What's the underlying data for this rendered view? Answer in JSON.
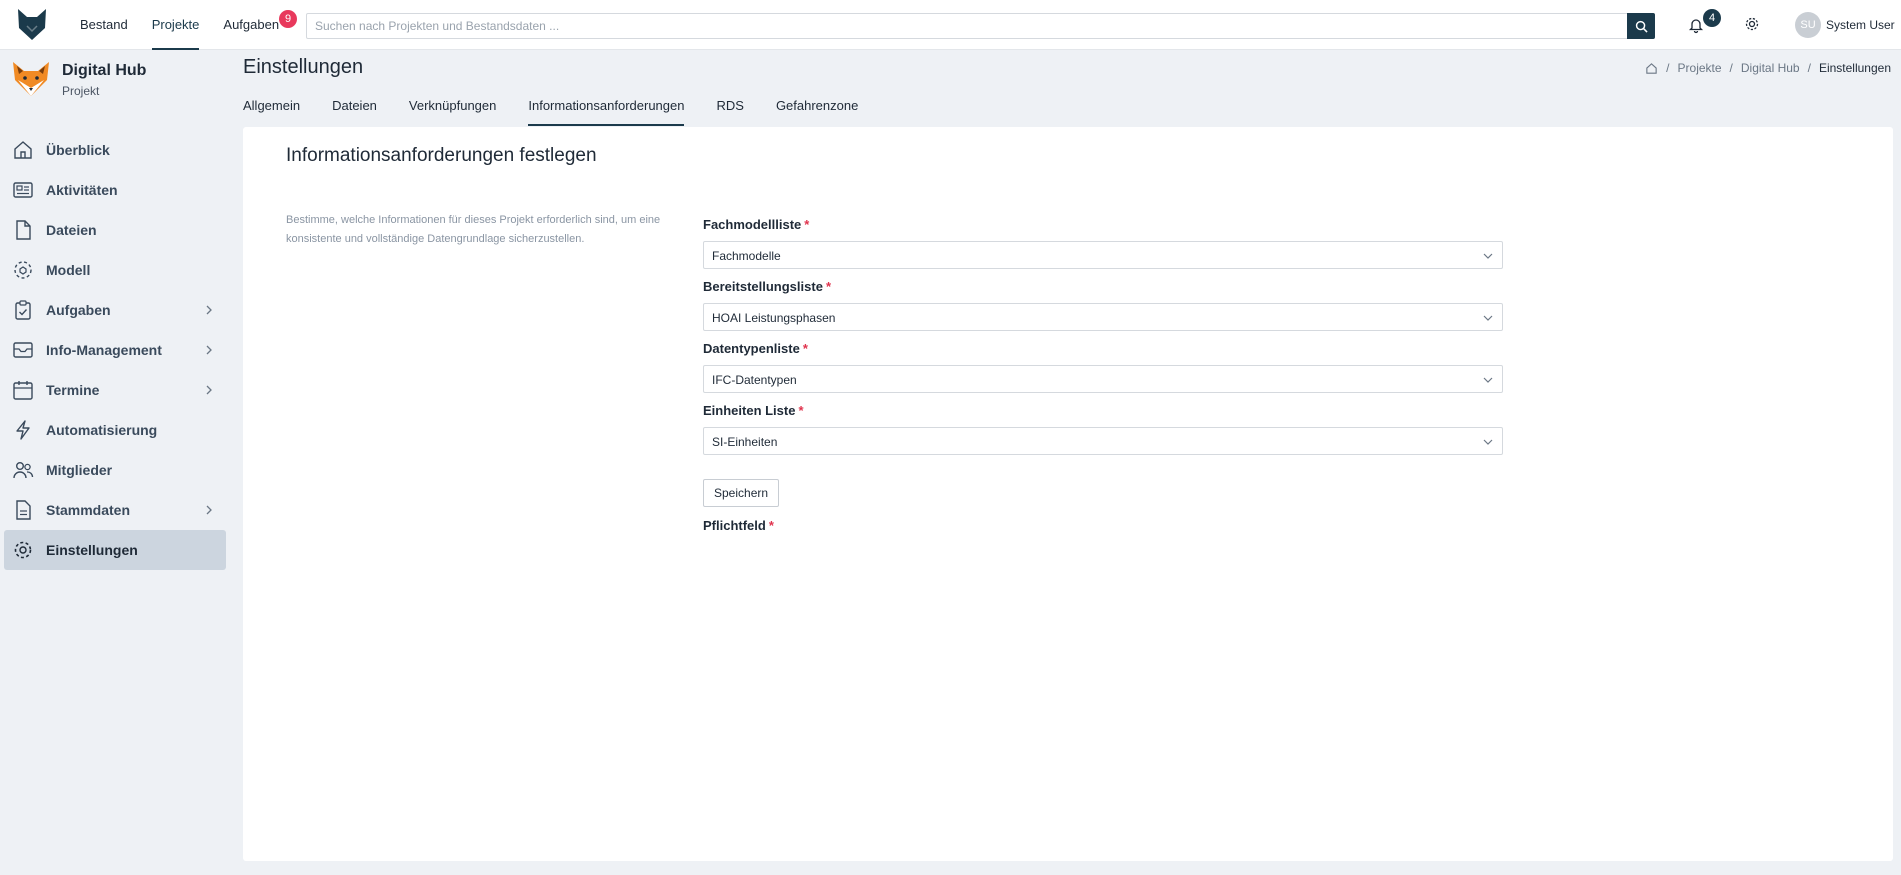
{
  "topbar": {
    "nav": [
      {
        "label": "Bestand",
        "active": false
      },
      {
        "label": "Projekte",
        "active": true
      },
      {
        "label": "Aufgaben",
        "active": false,
        "badge": "9"
      }
    ],
    "search_placeholder": "Suchen nach Projekten und Bestandsdaten ...",
    "notifications_count": "4",
    "user": {
      "initials": "SU",
      "name": "System User"
    }
  },
  "project": {
    "title": "Digital Hub",
    "subtitle": "Projekt"
  },
  "sidebar": {
    "items": [
      {
        "label": "Überblick",
        "icon": "home-icon",
        "has_children": false,
        "active": false
      },
      {
        "label": "Aktivitäten",
        "icon": "newspaper-icon",
        "has_children": false,
        "active": false
      },
      {
        "label": "Dateien",
        "icon": "file-icon",
        "has_children": false,
        "active": false
      },
      {
        "label": "Modell",
        "icon": "model-icon",
        "has_children": false,
        "active": false
      },
      {
        "label": "Aufgaben",
        "icon": "clipboard-check-icon",
        "has_children": true,
        "active": false
      },
      {
        "label": "Info-Management",
        "icon": "inbox-icon",
        "has_children": true,
        "active": false
      },
      {
        "label": "Termine",
        "icon": "calendar-icon",
        "has_children": true,
        "active": false
      },
      {
        "label": "Automatisierung",
        "icon": "lightning-icon",
        "has_children": false,
        "active": false
      },
      {
        "label": "Mitglieder",
        "icon": "people-icon",
        "has_children": false,
        "active": false
      },
      {
        "label": "Stammdaten",
        "icon": "document-icon",
        "has_children": true,
        "active": false
      },
      {
        "label": "Einstellungen",
        "icon": "gear-icon",
        "has_children": false,
        "active": true
      }
    ]
  },
  "page": {
    "title": "Einstellungen",
    "breadcrumb": [
      "Projekte",
      "Digital Hub",
      "Einstellungen"
    ],
    "tabs": [
      {
        "label": "Allgemein",
        "active": false
      },
      {
        "label": "Dateien",
        "active": false
      },
      {
        "label": "Verknüpfungen",
        "active": false
      },
      {
        "label": "Informationsanforderungen",
        "active": true
      },
      {
        "label": "RDS",
        "active": false
      },
      {
        "label": "Gefahrenzone",
        "active": false
      }
    ]
  },
  "content": {
    "title": "Informationsanforderungen festlegen",
    "description": "Bestimme, welche Informationen für dieses Projekt erforderlich sind, um eine konsistente und vollständige Datengrundlage sicherzustellen.",
    "fields": [
      {
        "label": "Fachmodellliste",
        "value": "Fachmodelle",
        "required": "*"
      },
      {
        "label": "Bereitstellungsliste",
        "value": "HOAI Leistungsphasen",
        "required": "*"
      },
      {
        "label": "Datentypenliste",
        "value": "IFC-Datentypen",
        "required": "*"
      },
      {
        "label": "Einheiten Liste",
        "value": "SI-Einheiten",
        "required": "*"
      }
    ],
    "save_label": "Speichern",
    "required_note": "Pflichtfeld",
    "required_mark": "*"
  },
  "colors": {
    "accent": "#1b3a4b",
    "badge_red": "#e8395c",
    "required": "#e0334d",
    "sidebar_active": "#ccd5df"
  }
}
